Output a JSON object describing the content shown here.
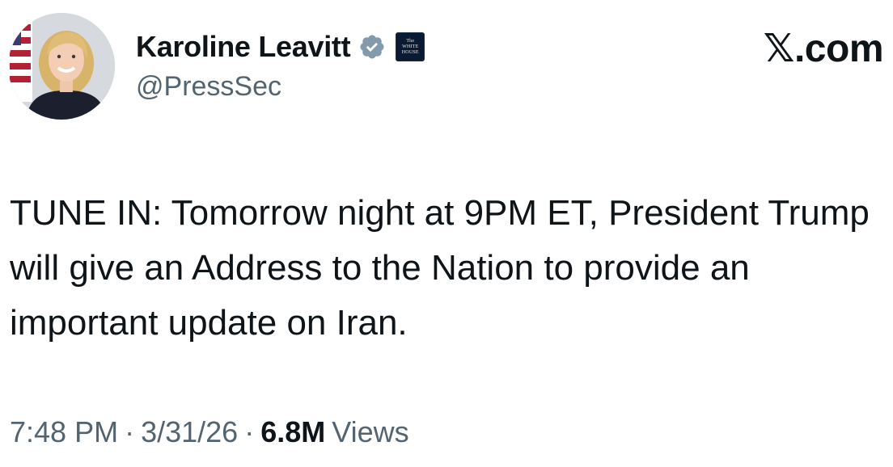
{
  "author": {
    "display_name": "Karoline Leavitt",
    "handle": "@PressSec",
    "verified_icon": "verified-badge-icon",
    "verified_color": "#829aab",
    "affiliation": {
      "icon": "white-house-badge-icon",
      "line1": "The",
      "line2": "WHITE",
      "line3": "HOUSE"
    }
  },
  "brand": {
    "label": "𝕏.com"
  },
  "tweet": {
    "text": "TUNE IN: Tomorrow night at 9PM ET, President Trump will give an Address to the Nation to provide an important update on Iran."
  },
  "meta": {
    "time": "7:48 PM",
    "separator": "·",
    "date": "3/31/26",
    "views_count": "6.8M",
    "views_label": "Views"
  },
  "colors": {
    "text_primary": "#0f1419",
    "text_secondary": "#536471",
    "affiliation_bg": "#0b1a33"
  }
}
